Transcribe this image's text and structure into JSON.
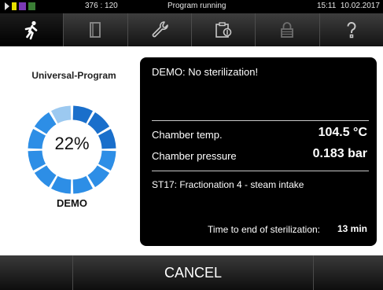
{
  "status_bar": {
    "coords": "376 : 120",
    "status": "Program running",
    "time": "15:11",
    "date": "10.02.2017"
  },
  "tabs": [
    {
      "name": "program",
      "icon": "running-person-icon",
      "active": true
    },
    {
      "name": "documents",
      "icon": "document-icon",
      "active": false
    },
    {
      "name": "settings",
      "icon": "wrench-icon",
      "active": false
    },
    {
      "name": "maintenance",
      "icon": "clipboard-icon",
      "active": false
    },
    {
      "name": "lock",
      "icon": "lock-icon",
      "active": false
    },
    {
      "name": "help",
      "icon": "help-icon",
      "active": false
    }
  ],
  "program": {
    "name": "Universal-Program",
    "progress": 0.22,
    "progress_label": "22%",
    "mode": "DEMO"
  },
  "panel": {
    "message": "DEMO: No sterilization!",
    "chamber_temp_label": "Chamber temp.",
    "chamber_temp_value": "104.5 °C",
    "chamber_pressure_label": "Chamber pressure",
    "chamber_pressure_value": "0.183 bar",
    "step": "ST17: Fractionation 4 - steam intake",
    "time_label": "Time to end of sterilization:",
    "time_value": "13 min"
  },
  "footer": {
    "cancel_label": "CANCEL"
  },
  "colors": {
    "progress_done": "#1a6fcb",
    "progress_remaining": "#2d8ee6",
    "progress_light": "#9cc9f0"
  }
}
